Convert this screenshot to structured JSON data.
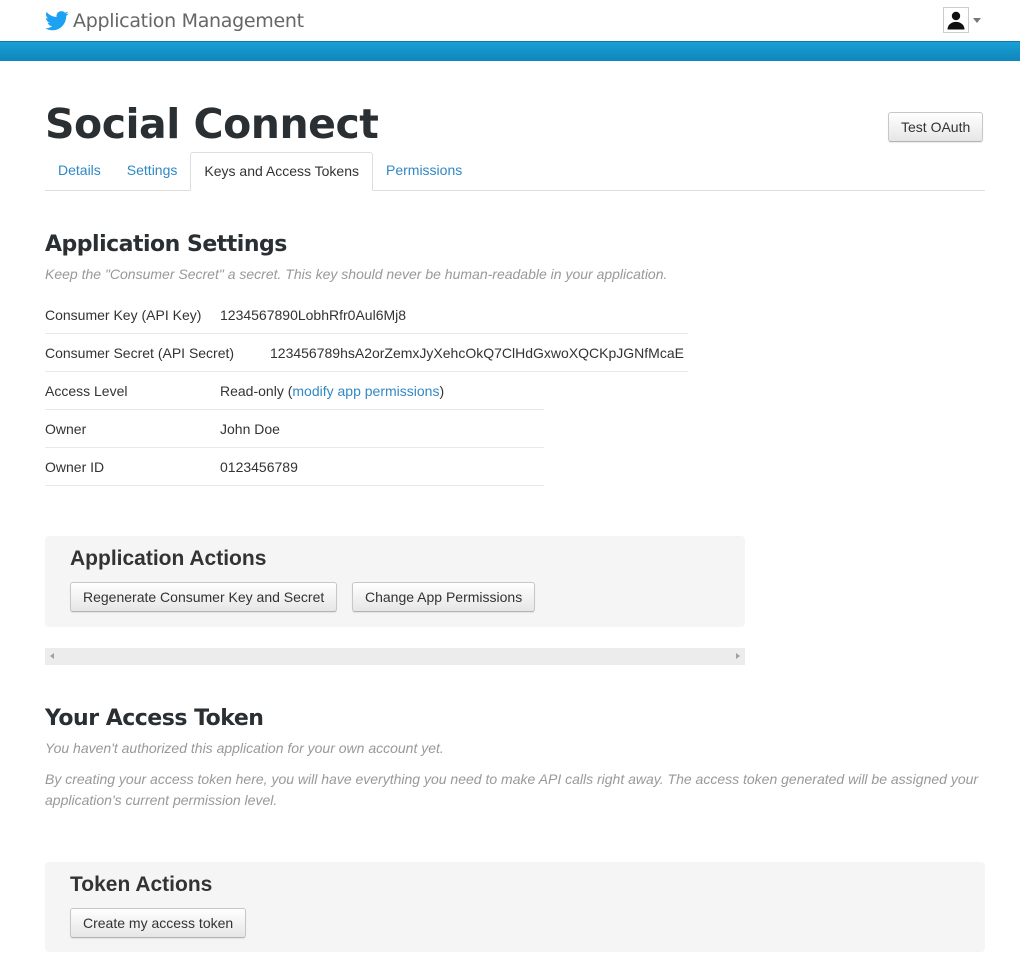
{
  "header": {
    "app_title": "Application Management",
    "logo_icon": "twitter-bird-icon",
    "user_icon": "user-silhouette-icon",
    "accent_color": "#1a9fd6"
  },
  "page": {
    "title": "Social Connect",
    "test_oauth_label": "Test OAuth"
  },
  "tabs": [
    {
      "label": "Details",
      "active": false
    },
    {
      "label": "Settings",
      "active": false
    },
    {
      "label": "Keys and Access Tokens",
      "active": true
    },
    {
      "label": "Permissions",
      "active": false
    }
  ],
  "app_settings": {
    "heading": "Application Settings",
    "hint": "Keep the \"Consumer Secret\" a secret. This key should never be human-readable in your application.",
    "consumer_key_label": "Consumer Key (API Key)",
    "consumer_key_value": "1234567890LobhRfr0Aul6Mj8",
    "consumer_secret_label": "Consumer Secret (API Secret)",
    "consumer_secret_value": "123456789hsA2orZemxJyXehcOkQ7ClHdGxwoXQCKpJGNfMcaE",
    "access_level_label": "Access Level",
    "access_level_value": "Read-only",
    "access_level_open_paren": "(",
    "access_level_link": "modify app permissions",
    "access_level_close_paren": ")",
    "owner_label": "Owner",
    "owner_value": "John Doe",
    "owner_id_label": "Owner ID",
    "owner_id_value": "0123456789"
  },
  "app_actions": {
    "heading": "Application Actions",
    "regenerate_label": "Regenerate Consumer Key and Secret",
    "change_permissions_label": "Change App Permissions"
  },
  "access_token": {
    "heading": "Your Access Token",
    "not_authorized": "You haven't authorized this application for your own account yet.",
    "description": "By creating your access token here, you will have everything you need to make API calls right away. The access token generated will be assigned your application's current permission level."
  },
  "token_actions": {
    "heading": "Token Actions",
    "create_label": "Create my access token"
  }
}
